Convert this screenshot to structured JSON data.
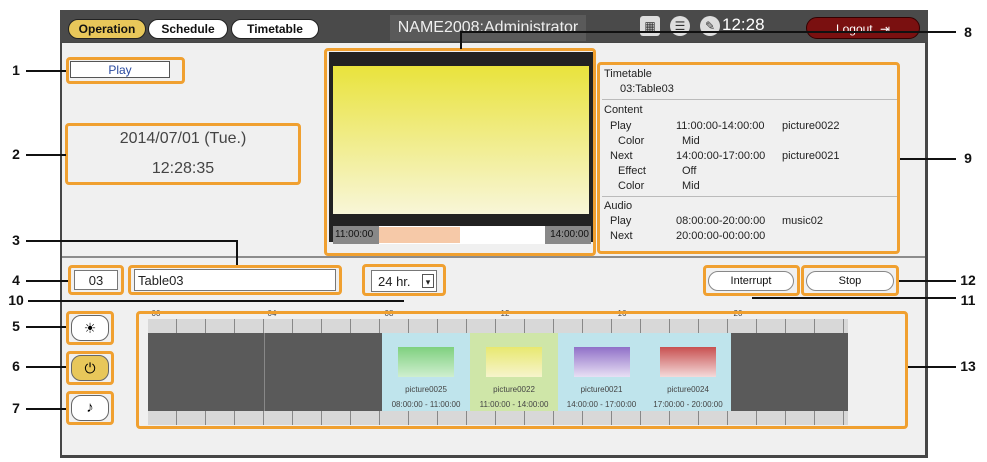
{
  "header": {
    "tabs": [
      {
        "label": "Operation"
      },
      {
        "label": "Schedule"
      },
      {
        "label": "Timetable"
      }
    ],
    "title": "NAME2008:Administrator",
    "time": "12:28",
    "logout_label": "Logout"
  },
  "status": {
    "mode": "Play"
  },
  "datetime": {
    "date": "2014/07/01 (Tue.)",
    "time": "12:28:35"
  },
  "table": {
    "number": "03",
    "name": "Table03"
  },
  "range": {
    "selected": "24 hr."
  },
  "buttons": {
    "interrupt": "Interrupt",
    "stop": "Stop"
  },
  "preview": {
    "start_time": "11:00:00",
    "end_time": "14:00:00",
    "progress_fraction": 0.5
  },
  "info": {
    "timetable_heading": "Timetable",
    "timetable_value": "03:Table03",
    "content_heading": "Content",
    "play_label": "Play",
    "play_time": "11:00:00-14:00:00",
    "play_item": "picture0022",
    "color_label": "Color",
    "color_value": "Mid",
    "next_label": "Next",
    "next_time": "14:00:00-17:00:00",
    "next_item": "picture0021",
    "effect_label": "Effect",
    "effect_value": "Off",
    "color2_label": "Color",
    "color2_value": "Mid",
    "audio_heading": "Audio",
    "audio_play_label": "Play",
    "audio_play_time": "08:00:00-20:00:00",
    "audio_play_item": "music02",
    "audio_next_label": "Next",
    "audio_next_time": "20:00:00-00:00:00"
  },
  "timeline": {
    "ticks": [
      "00",
      "04",
      "08",
      "12",
      "16",
      "20"
    ],
    "items": [
      {
        "name": "picture0025",
        "time": "08:00:00 - 11:00:00"
      },
      {
        "name": "picture0022",
        "time": "11:00:00 - 14:00:00"
      },
      {
        "name": "picture0021",
        "time": "14:00:00 - 17:00:00"
      },
      {
        "name": "picture0024",
        "time": "17:00:00 - 20:00:00"
      }
    ]
  },
  "callouts": [
    "1",
    "2",
    "3",
    "4",
    "5",
    "6",
    "7",
    "8",
    "9",
    "10",
    "11",
    "12",
    "13"
  ],
  "icons": {
    "brightness": "sun-icon",
    "power": "power-icon",
    "audio": "music-note-icon",
    "calendar": "calendar-icon",
    "list": "list-icon",
    "settings": "wrench-icon",
    "logout": "logout-icon"
  },
  "colors": {
    "active_tab": "#e8c75a",
    "highlight": "#f0a030",
    "logout": "#7a1010"
  }
}
